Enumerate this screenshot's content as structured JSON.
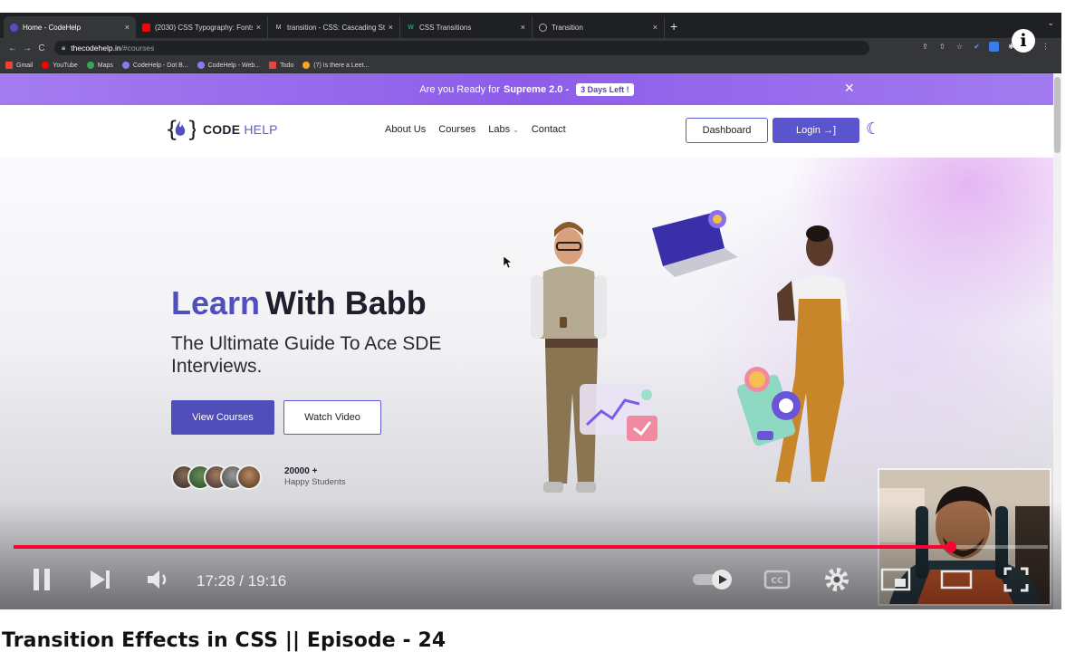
{
  "browser": {
    "tabs": [
      {
        "label": "Home - CodeHelp",
        "fav_color": "#8a7cf0",
        "active": true
      },
      {
        "label": "(2030) CSS Typography: Fonts",
        "fav_color": "#ff0000",
        "active": false
      },
      {
        "label": "transition - CSS: Cascading St",
        "fav_color": "#444444",
        "active": false
      },
      {
        "label": "CSS Transitions",
        "fav_color": "#04aa6d",
        "active": false
      },
      {
        "label": "Transition",
        "fav_color": "#999999",
        "active": false
      }
    ],
    "new_tab": "+",
    "url_host": "thecodehelp.in",
    "url_path": "/#courses",
    "bookmarks": [
      {
        "label": "Gmail",
        "color": "#ea4335"
      },
      {
        "label": "YouTube",
        "color": "#ff0000"
      },
      {
        "label": "Maps",
        "color": "#34a853"
      },
      {
        "label": "CodeHelp - Dot B...",
        "color": "#8a7cf0"
      },
      {
        "label": "CodeHelp - Web...",
        "color": "#8a7cf0"
      },
      {
        "label": "Todo",
        "color": "#e8453c"
      },
      {
        "label": "(7) Is there a Leet...",
        "color": "#f5a623"
      }
    ]
  },
  "site": {
    "promo_prefix": "Are you Ready for",
    "promo_bold": "Supreme 2.0 -",
    "promo_badge": "3 Days Left !",
    "promo_close": "×",
    "logo_word1": "CODE",
    "logo_word2": "HELP",
    "nav": {
      "about": "About Us",
      "courses": "Courses",
      "labs": "Labs",
      "contact": "Contact"
    },
    "dashboard_label": "Dashboard",
    "login_label": "Login →]",
    "hero_title_accent": "Learn",
    "hero_title_rest": "With Babb",
    "hero_subtitle": "The Ultimate Guide To Ace SDE Interviews.",
    "view_courses": "View Courses",
    "watch_video": "Watch Video",
    "students_count": "20000 +",
    "students_label": "Happy Students"
  },
  "player": {
    "current_time": "17:28",
    "duration": "19:16",
    "timecode": "17:28 / 19:16",
    "progress": 0.906,
    "accent": "#ff0033",
    "info": "i"
  },
  "video_title": "Transition Effects in CSS || Episode - 24"
}
